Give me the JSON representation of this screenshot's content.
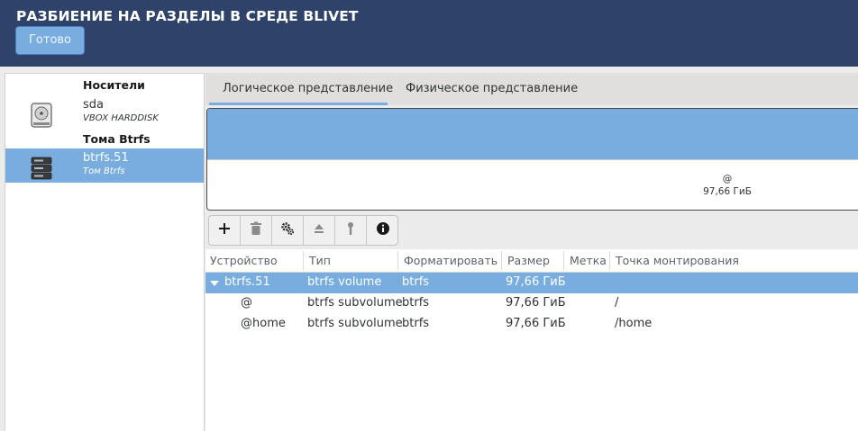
{
  "header": {
    "title": "РАЗБИЕНИЕ НА РАЗДЕЛЫ В СРЕДЕ BLIVET",
    "done_label": "Готово"
  },
  "sidebar": {
    "sections": [
      {
        "title": "Носители",
        "items": [
          {
            "name": "sda",
            "subtitle": "VBOX HARDDISK",
            "icon": "harddisk-icon",
            "selected": false
          }
        ]
      },
      {
        "title": "Тома Btrfs",
        "items": [
          {
            "name": "btrfs.51",
            "subtitle": "Том Btrfs",
            "icon": "btrfs-volume-icon",
            "selected": true
          }
        ]
      }
    ]
  },
  "tabs": [
    {
      "label": "Логическое представление",
      "active": true
    },
    {
      "label": "Физическое представление",
      "active": false
    }
  ],
  "partition_view": {
    "name": "@",
    "size": "97,66 ГиБ"
  },
  "toolbar": {
    "buttons": [
      "add-icon",
      "delete-icon",
      "settings-icon",
      "eject-icon",
      "mount-icon",
      "info-icon"
    ]
  },
  "table": {
    "columns": [
      "Устройство",
      "Тип",
      "Форматировать",
      "Размер",
      "Метка",
      "Точка монтирования"
    ],
    "rows": [
      {
        "device": "btrfs.51",
        "type": "btrfs volume",
        "format": "btrfs",
        "size": "97,66 ГиБ",
        "label": "",
        "mountpoint": "",
        "selected": true,
        "expanded": true
      },
      {
        "device": "@",
        "type": "btrfs subvolume",
        "format": "btrfs",
        "size": "97,66 ГиБ",
        "label": "",
        "mountpoint": "/",
        "selected": false
      },
      {
        "device": "@home",
        "type": "btrfs subvolume",
        "format": "btrfs",
        "size": "97,66 ГиБ",
        "label": "",
        "mountpoint": "/home",
        "selected": false
      }
    ]
  },
  "colors": {
    "header_bg": "#2e426a",
    "accent": "#79ade0"
  }
}
